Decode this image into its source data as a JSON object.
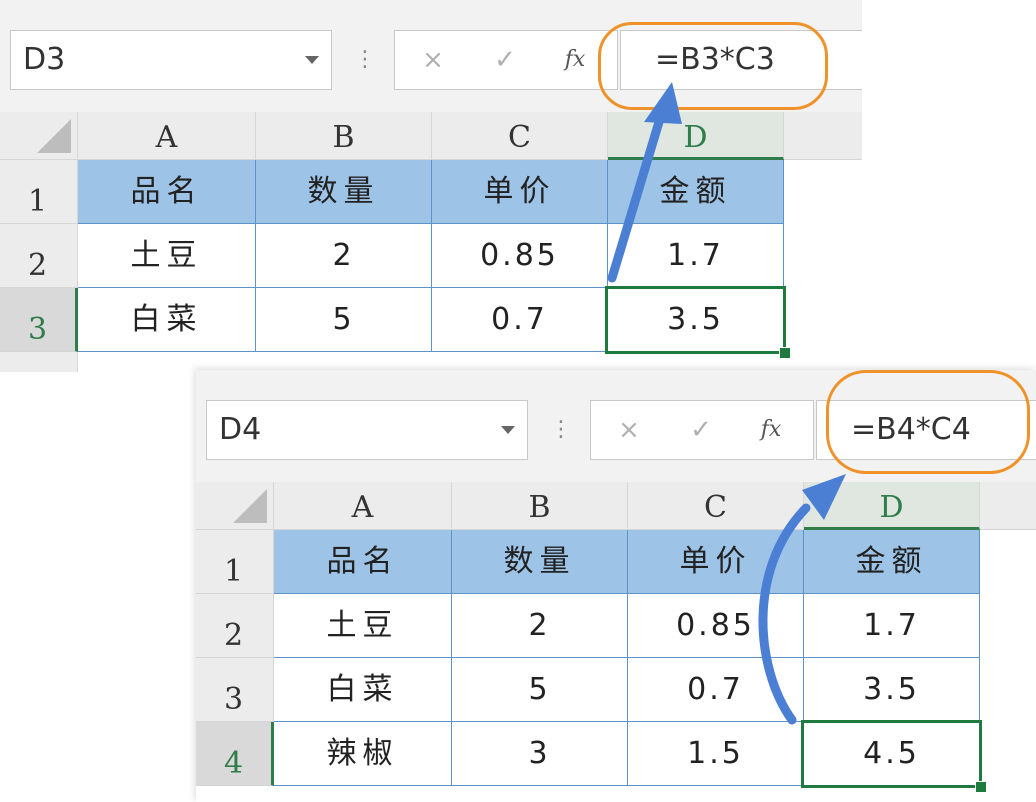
{
  "colors": {
    "header_fill": "#9dc3e6",
    "grid_blue": "#5d93c9",
    "selection_green": "#1f7a3f",
    "highlight_orange": "#f0922a",
    "arrow_blue": "#4a7fd4"
  },
  "icons": {
    "cancel": "×",
    "enter": "✓",
    "fx": "fx",
    "more": "⋮"
  },
  "top": {
    "name_box": "D3",
    "formula": "=B3*C3",
    "columns": [
      "A",
      "B",
      "C",
      "D"
    ],
    "rows": [
      "1",
      "2",
      "3"
    ],
    "cells": [
      [
        "品名",
        "数量",
        "单价",
        "金额"
      ],
      [
        "土豆",
        "2",
        "0.85",
        "1.7"
      ],
      [
        "白菜",
        "5",
        "0.7",
        "3.5"
      ]
    ]
  },
  "bottom": {
    "name_box": "D4",
    "formula": "=B4*C4",
    "columns": [
      "A",
      "B",
      "C",
      "D"
    ],
    "rows": [
      "1",
      "2",
      "3",
      "4"
    ],
    "cells": [
      [
        "品名",
        "数量",
        "单价",
        "金额"
      ],
      [
        "土豆",
        "2",
        "0.85",
        "1.7"
      ],
      [
        "白菜",
        "5",
        "0.7",
        "3.5"
      ],
      [
        "辣椒",
        "3",
        "1.5",
        "4.5"
      ]
    ]
  }
}
